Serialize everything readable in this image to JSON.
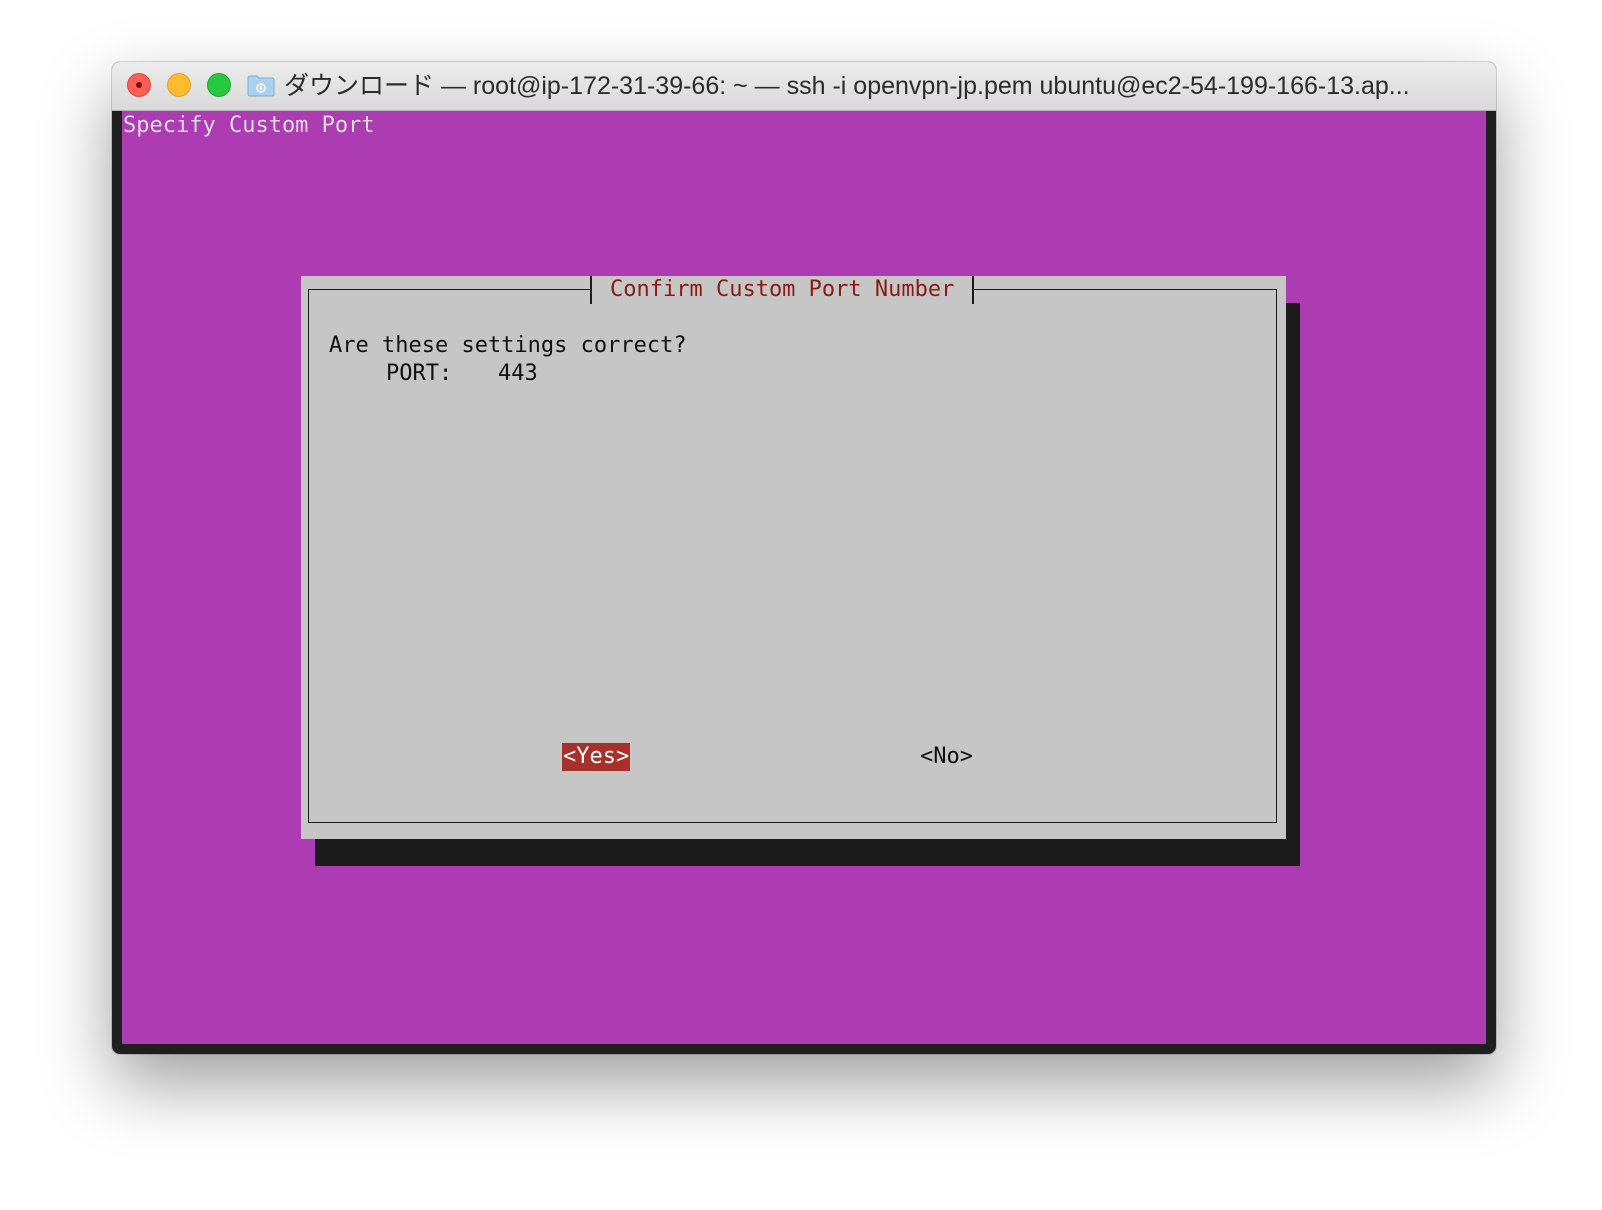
{
  "window": {
    "title": "ダウンロード — root@ip-172-31-39-66: ~ — ssh -i openvpn-jp.pem ubuntu@ec2-54-199-166-13.ap..."
  },
  "terminal": {
    "background_title": "Specify Custom Port",
    "background_color": "#ad3cb3"
  },
  "dialog": {
    "title": "Confirm Custom Port Number",
    "message": "Are these settings correct?",
    "port_label": "PORT:",
    "port_value": "443",
    "yes_label": "<Yes>",
    "no_label": "<No>",
    "selected_button": "yes",
    "accent_color": "#a7302a"
  },
  "icons": [
    "close-icon",
    "minimize-icon",
    "maximize-icon",
    "folder-icon"
  ]
}
